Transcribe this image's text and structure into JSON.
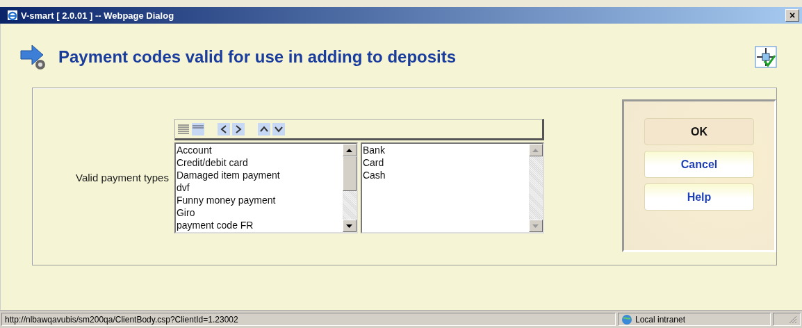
{
  "window": {
    "title": "V-smart [ 2.0.01 ] -- Webpage Dialog",
    "close": "×"
  },
  "heading": "Payment codes valid for use in adding to deposits",
  "field": {
    "label": "Valid payment types",
    "available": [
      "Account",
      "Credit/debit card",
      "Damaged item payment",
      "dvf",
      "Funny money payment",
      "Giro",
      "payment code FR"
    ],
    "chosen": [
      "Bank",
      "Card",
      "Cash"
    ]
  },
  "buttons": [
    {
      "label": "OK",
      "default": true
    },
    {
      "label": "Cancel",
      "default": false
    },
    {
      "label": "Help",
      "default": false
    }
  ],
  "status_bar": {
    "url": "http://nlbawqavubis/sm200qa/ClientBody.csp?ClientId=1.23002",
    "zone": "Local intranet"
  }
}
